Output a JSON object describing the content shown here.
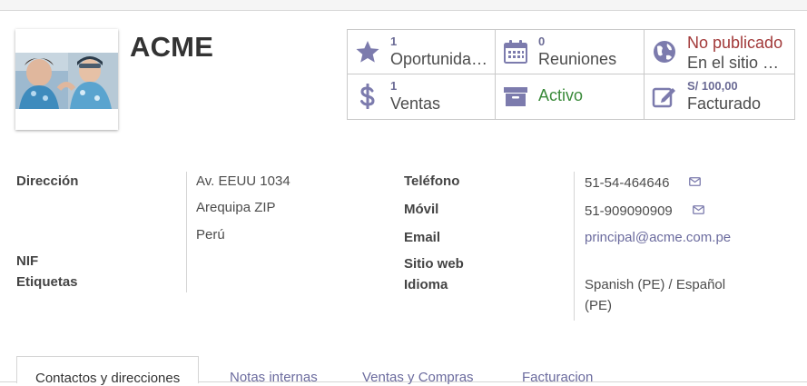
{
  "partner": {
    "name": "ACME"
  },
  "stats": {
    "opportunities": {
      "count": "1",
      "label": "Oportunida…"
    },
    "meetings": {
      "count": "0",
      "label": "Reuniones"
    },
    "publish": {
      "line1": "No publicado",
      "line2": "En el sitio …"
    },
    "sales": {
      "count": "1",
      "label": "Ventas"
    },
    "active": {
      "label": "Activo"
    },
    "invoiced": {
      "amount": "S/ 100,00",
      "label": "Facturado"
    }
  },
  "labels": {
    "address": "Dirección",
    "vat": "NIF",
    "tags": "Etiquetas",
    "phone": "Teléfono",
    "mobile": "Móvil",
    "email": "Email",
    "website": "Sitio web",
    "language": "Idioma"
  },
  "values": {
    "street": "Av. EEUU 1034",
    "city_zip": "Arequipa ZIP",
    "country": "Perú",
    "phone": "51-54-464646",
    "mobile": "51-909090909",
    "email": "principal@acme.com.pe",
    "language_line1": "Spanish (PE) / Español",
    "language_line2": "(PE)"
  },
  "tabs": [
    "Contactos y direcciones",
    "Notas internas",
    "Ventas y Compras",
    "Facturacion"
  ],
  "colors": {
    "accent": "#7c7bad",
    "unpublished": "#a23a3a",
    "active": "#3a8a3a",
    "link": "#6b6b9e"
  }
}
